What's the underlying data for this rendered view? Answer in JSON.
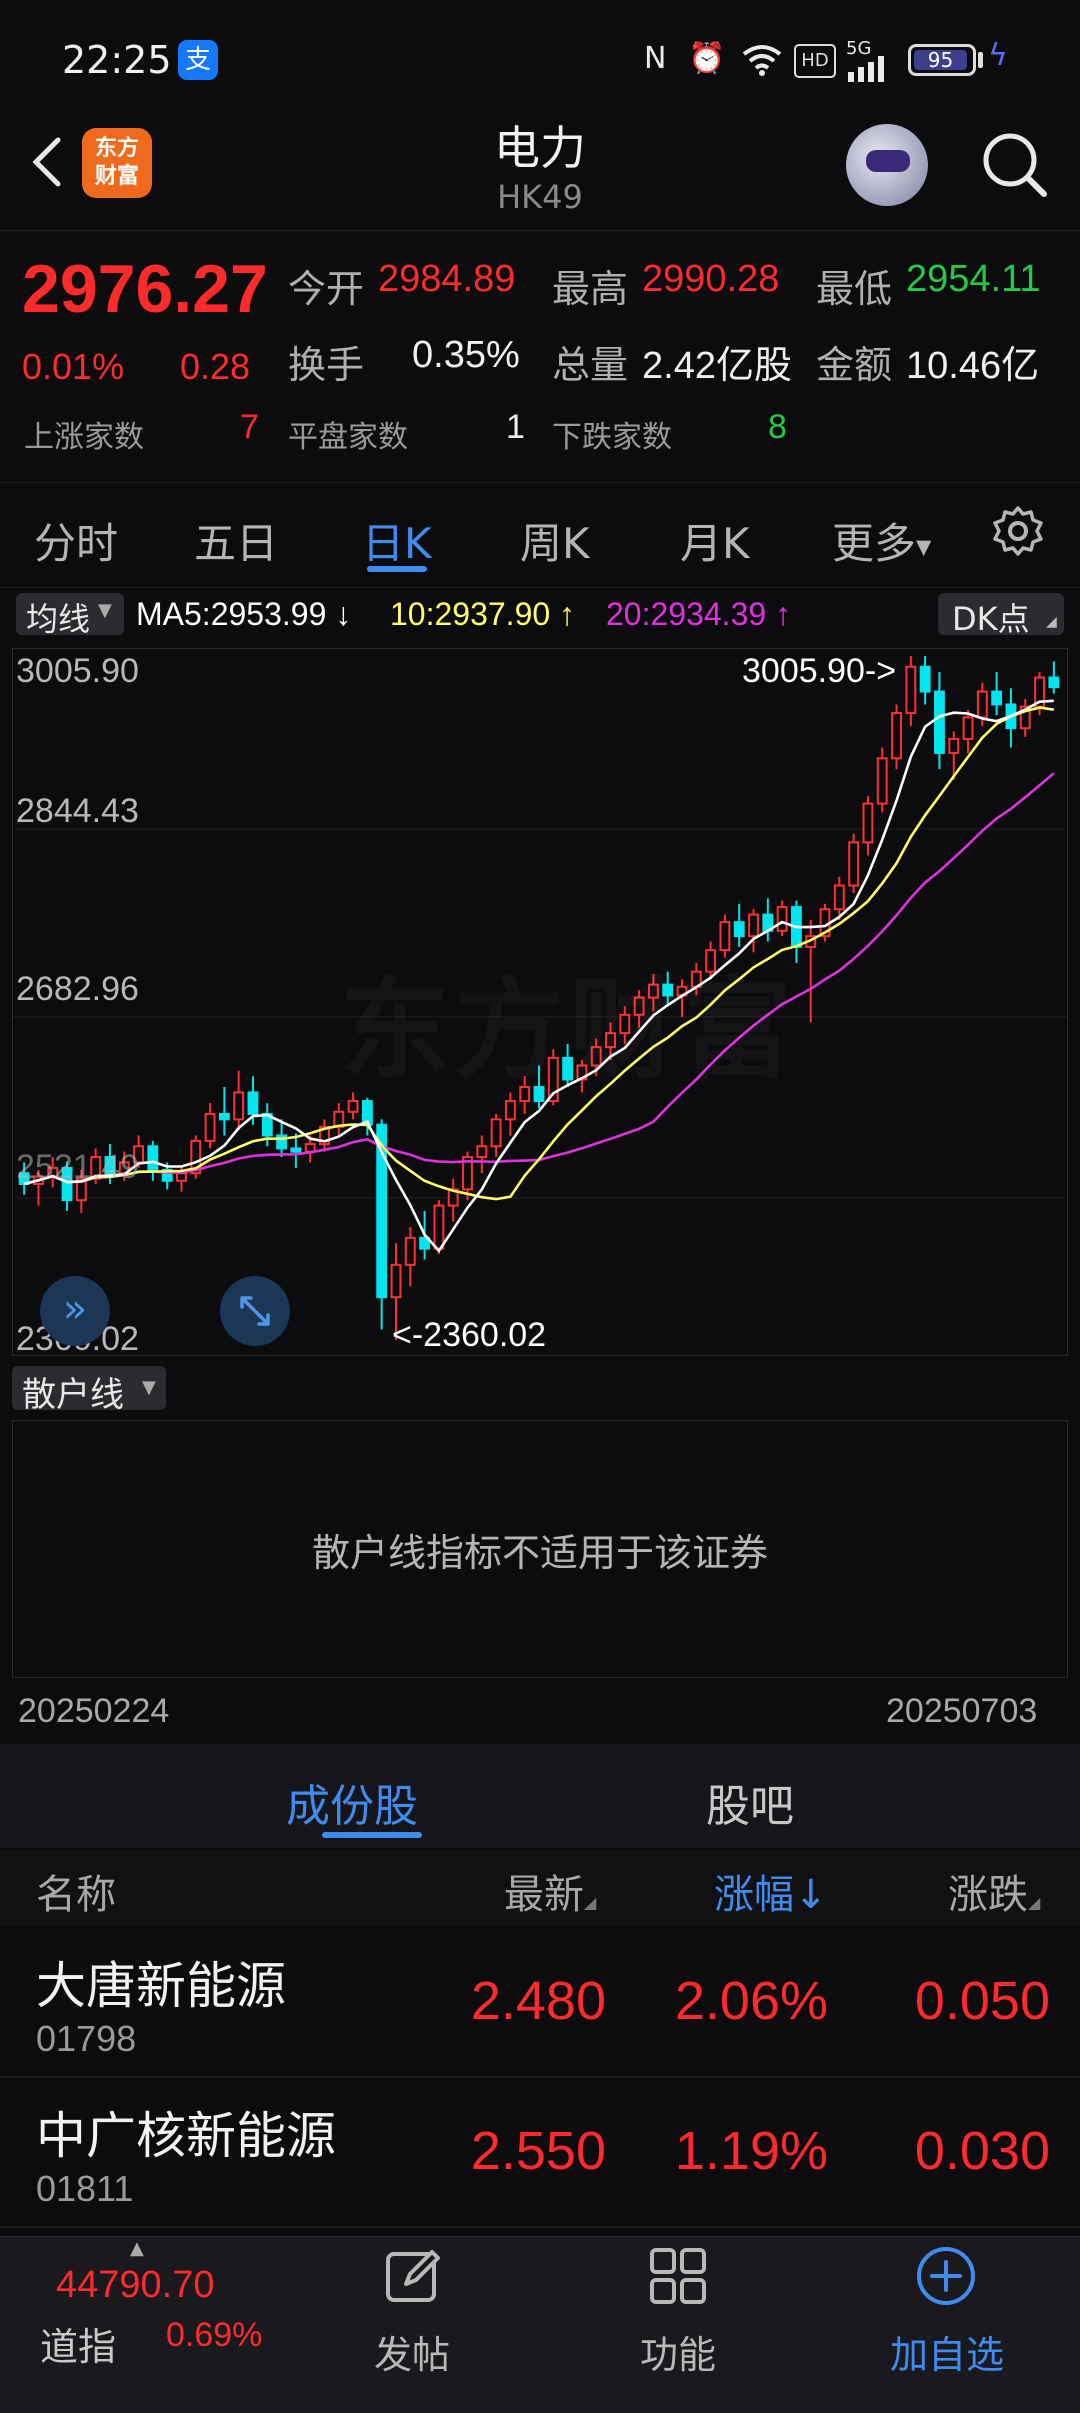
{
  "status_bar": {
    "time": "22:25",
    "battery": "95",
    "network": "5G"
  },
  "header": {
    "title": "电力",
    "code": "HK49",
    "logo_text": "东方财富"
  },
  "quote": {
    "last": "2976.27",
    "change_pct": "0.01%",
    "change_abs": "0.28",
    "open_label": "今开",
    "open": "2984.89",
    "high_label": "最高",
    "high": "2990.28",
    "low_label": "最低",
    "low": "2954.11",
    "turnover_label": "换手",
    "turnover": "0.35%",
    "volume_label": "总量",
    "volume": "2.42亿股",
    "amount_label": "金额",
    "amount": "10.46亿",
    "up_label": "上涨家数",
    "up": "7",
    "flat_label": "平盘家数",
    "flat": "1",
    "down_label": "下跌家数",
    "down": "8"
  },
  "period_tabs": {
    "fenshi": "分时",
    "wuri": "五日",
    "rik": "日K",
    "zhouk": "周K",
    "yuek": "月K",
    "more": "更多"
  },
  "ma_bar": {
    "button": "均线",
    "ma5": "MA5:2953.99",
    "ma5_arrow": "↓",
    "ma10": "10:2937.90",
    "ma10_arrow": "↑",
    "ma20": "20:2934.39",
    "ma20_arrow": "↑",
    "dk_button": "DK点",
    "colors": {
      "ma5": "#ffffff",
      "ma10": "#ffff66",
      "ma20": "#e030e0",
      "up": "#ff3030",
      "down": "#00e5ee"
    }
  },
  "chart_data": {
    "type": "candlestick",
    "ylim": [
      2360.02,
      3005.9
    ],
    "y_ticks": [
      "3005.90",
      "2844.43",
      "2682.96",
      "2521.49",
      "2360.02"
    ],
    "max_marker": "3005.90->",
    "min_marker": "<-2360.02",
    "watermark": "东方财富",
    "x_start": "20250224",
    "x_end": "20250703",
    "candles": [
      [
        2525,
        2535,
        2505,
        2515
      ],
      [
        2515,
        2528,
        2495,
        2522
      ],
      [
        2522,
        2540,
        2512,
        2530
      ],
      [
        2530,
        2536,
        2490,
        2500
      ],
      [
        2500,
        2528,
        2488,
        2520
      ],
      [
        2520,
        2548,
        2515,
        2540
      ],
      [
        2540,
        2552,
        2515,
        2525
      ],
      [
        2525,
        2545,
        2518,
        2535
      ],
      [
        2535,
        2560,
        2530,
        2550
      ],
      [
        2550,
        2555,
        2518,
        2528
      ],
      [
        2528,
        2535,
        2510,
        2518
      ],
      [
        2518,
        2532,
        2508,
        2525
      ],
      [
        2525,
        2560,
        2520,
        2555
      ],
      [
        2555,
        2590,
        2548,
        2580
      ],
      [
        2580,
        2605,
        2560,
        2575
      ],
      [
        2575,
        2620,
        2565,
        2600
      ],
      [
        2600,
        2615,
        2570,
        2580
      ],
      [
        2580,
        2590,
        2550,
        2560
      ],
      [
        2560,
        2575,
        2540,
        2548
      ],
      [
        2548,
        2562,
        2530,
        2545
      ],
      [
        2545,
        2560,
        2535,
        2552
      ],
      [
        2552,
        2575,
        2545,
        2568
      ],
      [
        2568,
        2590,
        2560,
        2582
      ],
      [
        2582,
        2600,
        2575,
        2592
      ],
      [
        2592,
        2595,
        2560,
        2570
      ],
      [
        2570,
        2575,
        2380,
        2410
      ],
      [
        2410,
        2460,
        2370,
        2440
      ],
      [
        2440,
        2475,
        2420,
        2465
      ],
      [
        2465,
        2490,
        2445,
        2455
      ],
      [
        2455,
        2500,
        2450,
        2495
      ],
      [
        2495,
        2520,
        2480,
        2510
      ],
      [
        2510,
        2545,
        2500,
        2540
      ],
      [
        2540,
        2560,
        2525,
        2550
      ],
      [
        2550,
        2580,
        2540,
        2575
      ],
      [
        2575,
        2600,
        2560,
        2592
      ],
      [
        2592,
        2615,
        2580,
        2605
      ],
      [
        2605,
        2625,
        2585,
        2592
      ],
      [
        2592,
        2640,
        2588,
        2632
      ],
      [
        2632,
        2645,
        2605,
        2612
      ],
      [
        2612,
        2630,
        2600,
        2625
      ],
      [
        2625,
        2650,
        2615,
        2642
      ],
      [
        2642,
        2665,
        2630,
        2655
      ],
      [
        2655,
        2680,
        2645,
        2672
      ],
      [
        2672,
        2695,
        2660,
        2688
      ],
      [
        2688,
        2710,
        2675,
        2700
      ],
      [
        2700,
        2712,
        2680,
        2690
      ],
      [
        2690,
        2705,
        2670,
        2698
      ],
      [
        2698,
        2720,
        2690,
        2712
      ],
      [
        2712,
        2740,
        2705,
        2732
      ],
      [
        2732,
        2765,
        2725,
        2758
      ],
      [
        2758,
        2775,
        2735,
        2745
      ],
      [
        2745,
        2770,
        2730,
        2765
      ],
      [
        2765,
        2780,
        2740,
        2750
      ],
      [
        2750,
        2778,
        2745,
        2772
      ],
      [
        2772,
        2778,
        2720,
        2735
      ],
      [
        2735,
        2760,
        2665,
        2745
      ],
      [
        2745,
        2775,
        2740,
        2770
      ],
      [
        2770,
        2800,
        2760,
        2792
      ],
      [
        2792,
        2840,
        2785,
        2832
      ],
      [
        2832,
        2875,
        2820,
        2868
      ],
      [
        2868,
        2920,
        2860,
        2910
      ],
      [
        2910,
        2960,
        2900,
        2952
      ],
      [
        2952,
        3005,
        2940,
        2995
      ],
      [
        2995,
        3005,
        2960,
        2972
      ],
      [
        2972,
        2990,
        2900,
        2915
      ],
      [
        2915,
        2935,
        2890,
        2928
      ],
      [
        2928,
        2955,
        2915,
        2948
      ],
      [
        2948,
        2980,
        2940,
        2972
      ],
      [
        2972,
        2990,
        2950,
        2960
      ],
      [
        2960,
        2975,
        2920,
        2938
      ],
      [
        2938,
        2965,
        2930,
        2958
      ],
      [
        2958,
        2990,
        2950,
        2985
      ],
      [
        2985,
        3000,
        2970,
        2976
      ]
    ]
  },
  "sub_indicator": {
    "button": "散户线",
    "message": "散户线指标不适用于该证券"
  },
  "components": {
    "tab_components": "成份股",
    "tab_forum": "股吧",
    "headers": {
      "name": "名称",
      "latest": "最新",
      "pct": "涨幅",
      "pct_arrow": "↓",
      "change": "涨跌"
    },
    "rows": [
      {
        "name": "大唐新能源",
        "code": "01798",
        "latest": "2.480",
        "pct": "2.06%",
        "change": "0.050"
      },
      {
        "name": "中广核新能源",
        "code": "01811",
        "latest": "2.550",
        "pct": "1.19%",
        "change": "0.030"
      }
    ]
  },
  "bottom_nav": {
    "dow_value": "44790.70",
    "dow_label": "道指",
    "dow_change": "0.69%",
    "post": "发帖",
    "functions": "功能",
    "add": "加自选"
  }
}
